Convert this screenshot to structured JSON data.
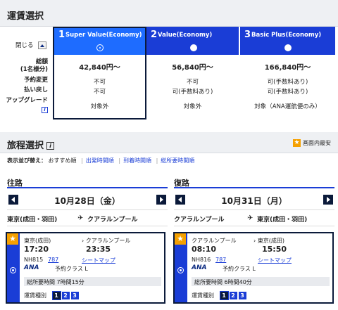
{
  "fare_section": {
    "title": "運賃選択",
    "close_label": "閉じる",
    "row_labels": [
      "総額",
      "(1名様分)",
      "予約変更",
      "払い戻し",
      "アップグレード"
    ],
    "columns": [
      {
        "num": "1",
        "name": "Super Value(Economy)",
        "price": "42,840円〜",
        "change": "不可",
        "refund": "不可",
        "upgrade": "対象外",
        "selected": true
      },
      {
        "num": "2",
        "name": "Value(Economy)",
        "price": "56,840円〜",
        "change": "不可",
        "refund": "可(手数料あり)",
        "upgrade": "対象外",
        "selected": false
      },
      {
        "num": "3",
        "name": "Basic Plus(Economy)",
        "price": "166,840円〜",
        "change": "可(手数料あり)",
        "refund": "可(手数料あり)",
        "upgrade": "対象（ANA運航便のみ）",
        "selected": false
      }
    ]
  },
  "itinerary": {
    "title": "旅程選択",
    "cheapest_label": "画面内最安",
    "sort_label": "表示並び替え：",
    "sort_current": "おすすめ順",
    "sort_links": [
      "出発時間順",
      "到着時間順",
      "総所要時間順"
    ],
    "legs": [
      {
        "title": "往路",
        "date": "10月28日（金）",
        "from": "東京(成田・羽田)",
        "to": "クアラルンプール",
        "flight": {
          "dep_airport": "東京(成田)",
          "arr_airport": "クアラルンプール",
          "dep_time": "17:20",
          "arr_time": "23:35",
          "flight_no": "NH815",
          "aircraft": "787",
          "seatmap": "シートマップ",
          "airline": "ANA",
          "booking_class": "予約クラス L",
          "duration": "総所要時間 7時間15分",
          "fare_type_label": "運賃種別",
          "fare_types": [
            "1",
            "2",
            "3"
          ]
        }
      },
      {
        "title": "復路",
        "date": "10月31日（月）",
        "from": "クアラルンプール",
        "to": "東京(成田・羽田)",
        "flight": {
          "dep_airport": "クアラルンプール",
          "arr_airport": "東京(成田)",
          "dep_time": "08:10",
          "arr_time": "15:50",
          "flight_no": "NH816",
          "aircraft": "787",
          "seatmap": "シートマップ",
          "airline": "ANA",
          "booking_class": "予約クラス L",
          "duration": "総所要時間 6時間40分",
          "fare_type_label": "運賃種別",
          "fare_types": [
            "1",
            "2",
            "3"
          ]
        }
      }
    ]
  },
  "colors": {
    "primary": "#1a3dd6",
    "selected": "#1e6cff",
    "dark": "#0b1a3a",
    "star": "#f5a000"
  }
}
